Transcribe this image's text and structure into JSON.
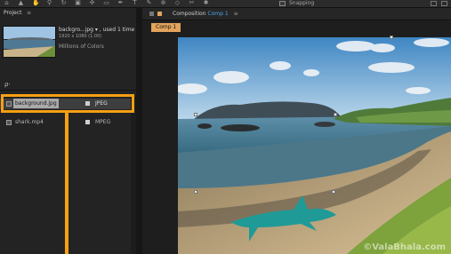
{
  "toolbar": {
    "snapping_label": "Snapping",
    "icons": [
      "home-icon",
      "selection-icon",
      "hand-icon",
      "zoom-icon",
      "rotate-icon",
      "camera-icon",
      "pan-icon",
      "rectangle-icon",
      "pen-icon",
      "text-icon",
      "brush-icon",
      "clone-icon",
      "eraser-icon",
      "roto-icon",
      "puppet-icon"
    ]
  },
  "project_panel": {
    "tab_label": "Project",
    "menu_glyph": "≡",
    "selected_file_name": "backgro...jpg ▾ , used 1 time",
    "selected_file_size": "1920 x 1080 (1.00)",
    "selected_file_colors": "Millions of Colors",
    "search_glyph": "ρ·",
    "files": [
      {
        "name": "background.jpg",
        "type": "JPEG",
        "selected": true
      },
      {
        "name": "shark.mp4",
        "type": "MPEG",
        "selected": false
      }
    ]
  },
  "composition_panel": {
    "title_prefix": "Composition",
    "title_name": "Comp 1",
    "menu_glyph": "≡",
    "subtab_label": "Comp 1",
    "watermark": "©ValaBhala.com"
  },
  "colors": {
    "highlight": "#f5a013",
    "accent": "#4aa6e8",
    "subtab": "#e2a45c"
  }
}
